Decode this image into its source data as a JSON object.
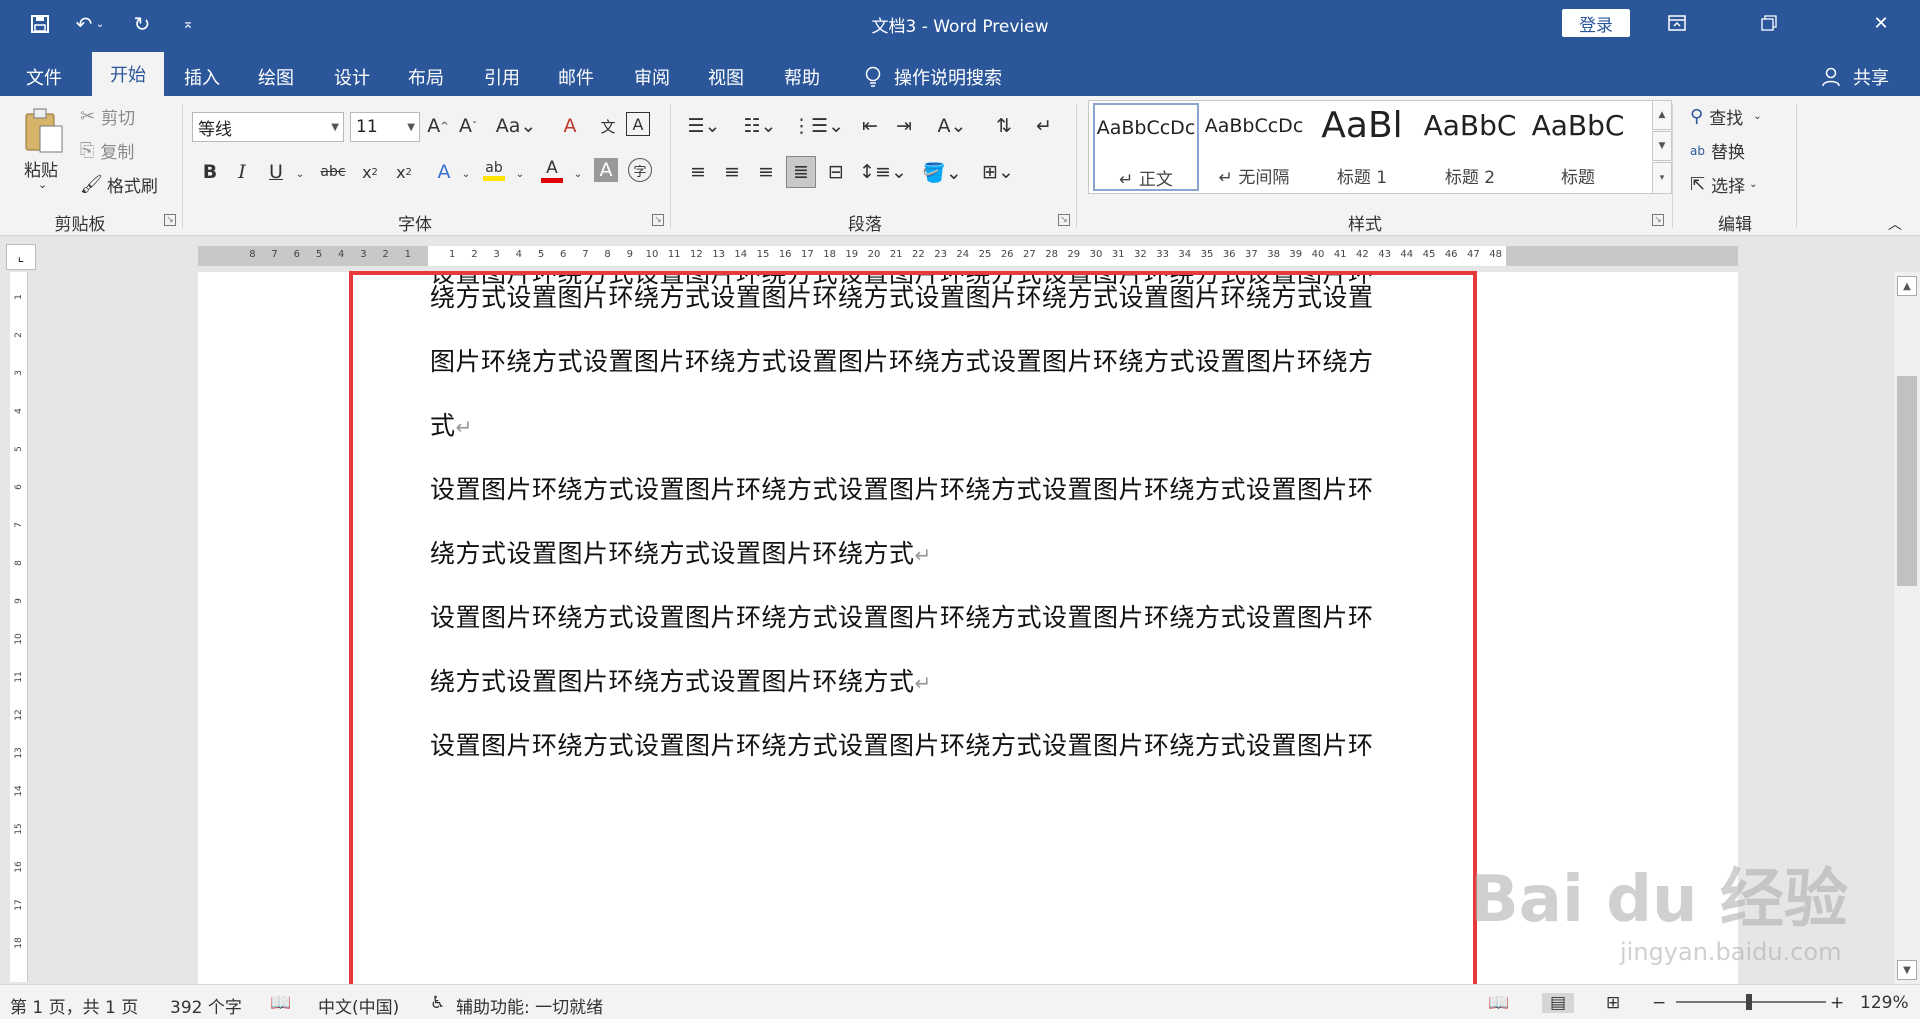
{
  "window": {
    "title": "文档3  -  Word Preview",
    "login_label": "登录",
    "controls": {
      "ribbon_display": "ribbon-display-icon",
      "restore": "restore-icon",
      "close": "close-icon"
    }
  },
  "quick_access": {
    "save": "save-icon",
    "undo": "undo-icon",
    "redo": "redo-icon",
    "customize": "customize-icon"
  },
  "tabs": [
    {
      "label": "文件",
      "active": false
    },
    {
      "label": "开始",
      "active": true
    },
    {
      "label": "插入",
      "active": false
    },
    {
      "label": "绘图",
      "active": false
    },
    {
      "label": "设计",
      "active": false
    },
    {
      "label": "布局",
      "active": false
    },
    {
      "label": "引用",
      "active": false
    },
    {
      "label": "邮件",
      "active": false
    },
    {
      "label": "审阅",
      "active": false
    },
    {
      "label": "视图",
      "active": false
    },
    {
      "label": "帮助",
      "active": false
    }
  ],
  "tell_me": "操作说明搜索",
  "share": "共享",
  "clipboard": {
    "group": "剪贴板",
    "paste": "粘贴",
    "cut": "剪切",
    "copy": "复制",
    "format_painter": "格式刷"
  },
  "font": {
    "group": "字体",
    "name": "等线",
    "size": "11"
  },
  "paragraph": {
    "group": "段落"
  },
  "styles": {
    "group": "样式",
    "items": [
      {
        "sample": "AaBbCcDc",
        "name": "↵ 正文",
        "selected": true
      },
      {
        "sample": "AaBbCcDc",
        "name": "↵ 无间隔",
        "selected": false
      },
      {
        "sample": "AaBl",
        "name": "标题 1",
        "selected": false
      },
      {
        "sample": "AaBbC",
        "name": "标题 2",
        "selected": false
      },
      {
        "sample": "AaBbC",
        "name": "标题",
        "selected": false
      }
    ]
  },
  "editing": {
    "group": "编辑",
    "find": "查找",
    "replace": "替换",
    "select": "选择"
  },
  "document": {
    "lines": [
      "设置图片环绕方式设置图片环绕方式设置图片环绕方式设置图片环绕方式设置图片环",
      "绕方式设置图片环绕方式设置图片环绕方式设置图片环绕方式设置图片环绕方式设置",
      "图片环绕方式设置图片环绕方式设置图片环绕方式设置图片环绕方式设置图片环绕方",
      "式",
      "设置图片环绕方式设置图片环绕方式设置图片环绕方式设置图片环绕方式设置图片环",
      "绕方式设置图片环绕方式设置图片环绕方式",
      "设置图片环绕方式设置图片环绕方式设置图片环绕方式设置图片环绕方式设置图片环",
      "绕方式设置图片环绕方式设置图片环绕方式",
      "设置图片环绕方式设置图片环绕方式设置图片环绕方式设置图片环绕方式设置图片环"
    ],
    "paragraph_mark": "↵"
  },
  "status": {
    "page": "第 1 页，共 1 页",
    "words": "392 个字",
    "language": "中文(中国)",
    "accessibility": "辅助功能: 一切就绪",
    "zoom": "129%"
  },
  "watermark": {
    "brand": "Bai du 经验",
    "site": "jingyan.baidu.com"
  },
  "colors": {
    "titlebar": "#2b579a",
    "ribbon": "#f3f3f3",
    "highlight_box": "#e83a3a",
    "font_color_red": "#e00000",
    "highlight_yellow": "#ffe400"
  }
}
